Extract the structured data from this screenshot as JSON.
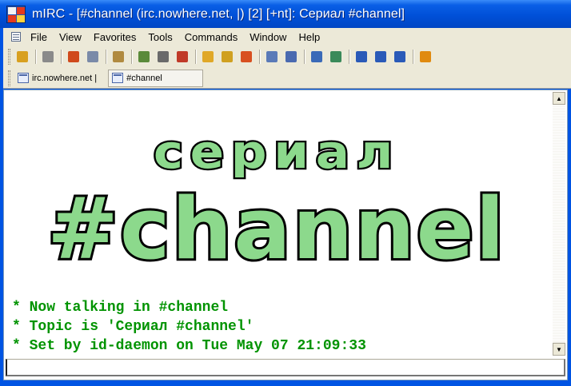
{
  "window": {
    "title": "mIRC - [#channel (irc.nowhere.net, |) [2] [+nt]: Сериал #channel]",
    "app_icon": "mirc-app-icon"
  },
  "menu": {
    "items": [
      "File",
      "View",
      "Favorites",
      "Tools",
      "Commands",
      "Window",
      "Help"
    ]
  },
  "toolbar": {
    "groups": [
      [
        {
          "icon": "connect-icon",
          "color": "#d8a020"
        }
      ],
      [
        {
          "icon": "options-icon",
          "color": "#8a8a8a"
        }
      ],
      [
        {
          "icon": "address-book-icon",
          "color": "#d04a1c"
        },
        {
          "icon": "notify-list-icon",
          "color": "#7a8aa8"
        }
      ],
      [
        {
          "icon": "channel-list-icon",
          "color": "#b08a40"
        }
      ],
      [
        {
          "icon": "received-files-icon",
          "color": "#5a8a3a"
        },
        {
          "icon": "timer-icon",
          "color": "#6a6a6a"
        },
        {
          "icon": "scripts-editor-icon",
          "color": "#c03a28"
        }
      ],
      [
        {
          "icon": "dcc-send-icon",
          "color": "#e0a828"
        },
        {
          "icon": "dcc-chat-icon",
          "color": "#d0a020"
        },
        {
          "icon": "dcc-options-icon",
          "color": "#d85020"
        }
      ],
      [
        {
          "icon": "list-channels-icon",
          "color": "#5a7ab8"
        },
        {
          "icon": "user-list-icon",
          "color": "#4a6ab0"
        }
      ],
      [
        {
          "icon": "log-files-icon",
          "color": "#3a6ab8"
        },
        {
          "icon": "urls-list-icon",
          "color": "#3a8a5a"
        }
      ],
      [
        {
          "icon": "tile-horizontal-icon",
          "color": "#2a5ab8"
        },
        {
          "icon": "tile-vertical-icon",
          "color": "#2a5ab8"
        },
        {
          "icon": "cascade-icon",
          "color": "#2a5ab8"
        }
      ],
      [
        {
          "icon": "help-icon",
          "color": "#e08a10"
        }
      ]
    ]
  },
  "switchbar": {
    "tabs": [
      {
        "label": "irc.nowhere.net |",
        "active": false
      },
      {
        "label": "#channel",
        "active": true
      }
    ]
  },
  "banner": {
    "line1": "сериал",
    "line2": "#channel",
    "fill": "#8cd98c",
    "outline": "#000000"
  },
  "chat": {
    "lines": [
      "* Now talking in #channel",
      "* Topic is 'Сериал #channel'",
      "* Set by id-daemon on Tue May 07 21:09:33"
    ],
    "color": "#009300"
  },
  "input": {
    "value": ""
  }
}
